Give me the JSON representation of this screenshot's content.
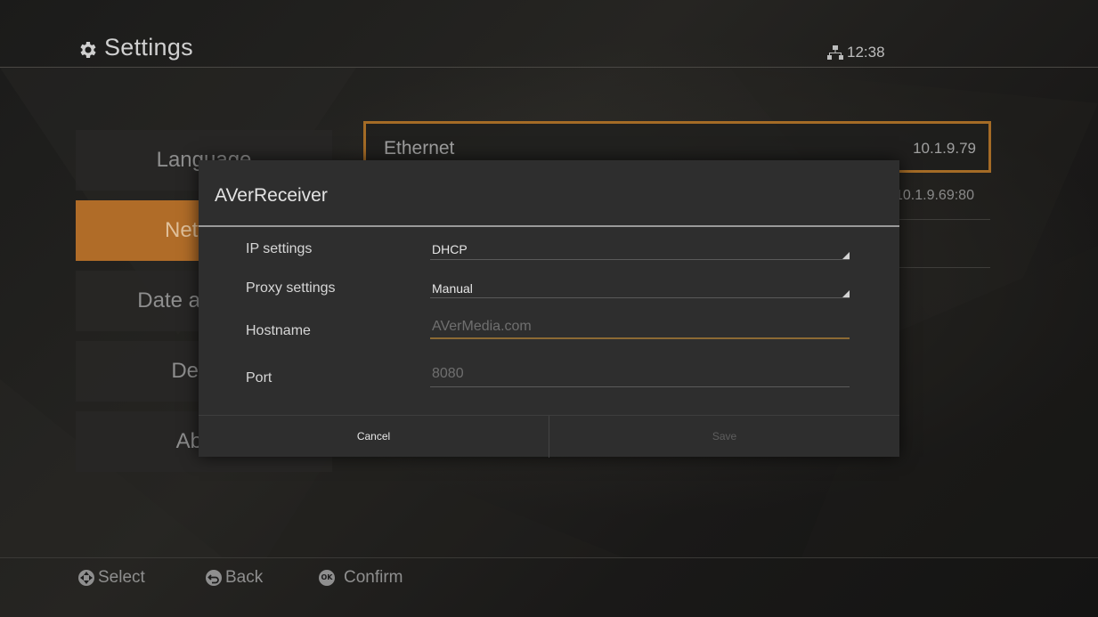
{
  "header": {
    "title": "Settings",
    "title_icon": "gear-icon",
    "network_icon": "network-icon",
    "clock": "12:38"
  },
  "menu": {
    "items": [
      {
        "label": "Language",
        "active": false
      },
      {
        "label": "Network",
        "active": true
      },
      {
        "label": "Date and time",
        "active": false
      },
      {
        "label": "Device",
        "active": false
      },
      {
        "label": "About",
        "active": false
      }
    ]
  },
  "network_panel": {
    "ethernet_label": "Ethernet",
    "ethernet_value": "10.1.9.79",
    "proxy_value": "10.1.9.69:80"
  },
  "dialog": {
    "title": "AVerReceiver",
    "ip_settings_label": "IP settings",
    "ip_settings_value": "DHCP",
    "proxy_settings_label": "Proxy settings",
    "proxy_settings_value": "Manual",
    "hostname_label": "Hostname",
    "hostname_placeholder": "AVerMedia.com",
    "port_label": "Port",
    "port_placeholder": "8080",
    "cancel_label": "Cancel",
    "save_label": "Save"
  },
  "footer": {
    "select_label": "Select",
    "back_label": "Back",
    "confirm_label": "Confirm",
    "ok_badge": "OK"
  },
  "colors": {
    "accent": "#b06c28",
    "focus_border": "#a46b26"
  }
}
